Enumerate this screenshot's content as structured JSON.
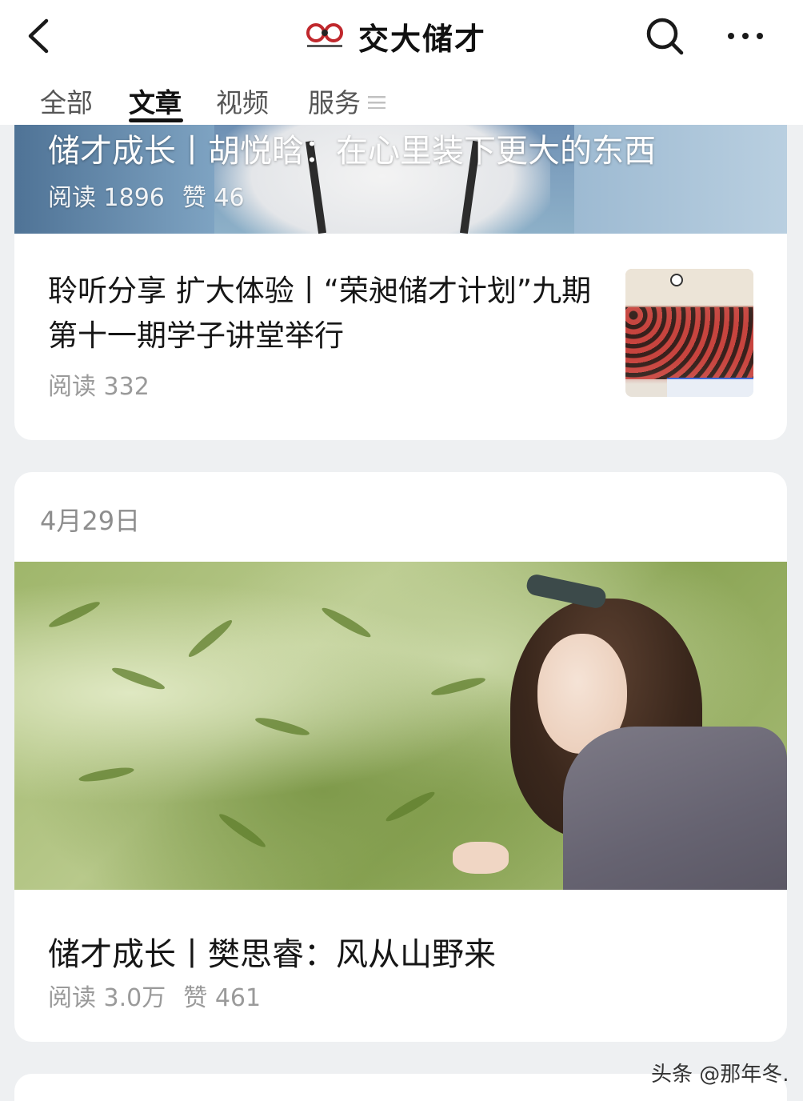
{
  "header": {
    "title": "交大储才",
    "back_icon": "chevron-left-icon",
    "search_icon": "search-icon",
    "more_icon": "more-dots-icon"
  },
  "tabs": [
    {
      "label": "全部",
      "active": false
    },
    {
      "label": "文章",
      "active": true
    },
    {
      "label": "视频",
      "active": false
    },
    {
      "label": "服务",
      "active": false
    }
  ],
  "articles": [
    {
      "title": "储才成长丨胡悦晗：在心里装下更大的东西",
      "reads_label": "阅读",
      "reads": "1896",
      "likes_label": "赞",
      "likes": "46"
    },
    {
      "title": "聆听分享 扩大体验丨“荣昶储才计划”九期第十一期学子讲堂举行",
      "reads_label": "阅读",
      "reads": "332"
    },
    {
      "date": "4月29日",
      "title": "储才成长丨樊思睿：风从山野来",
      "reads_label": "阅读",
      "reads": "3.0万",
      "likes_label": "赞",
      "likes": "461"
    }
  ],
  "watermark": "头条 @那年冬.",
  "colors": {
    "background": "#eef0f2",
    "card": "#ffffff",
    "meta_text": "#9a9a9a",
    "primary_text": "#161616"
  }
}
